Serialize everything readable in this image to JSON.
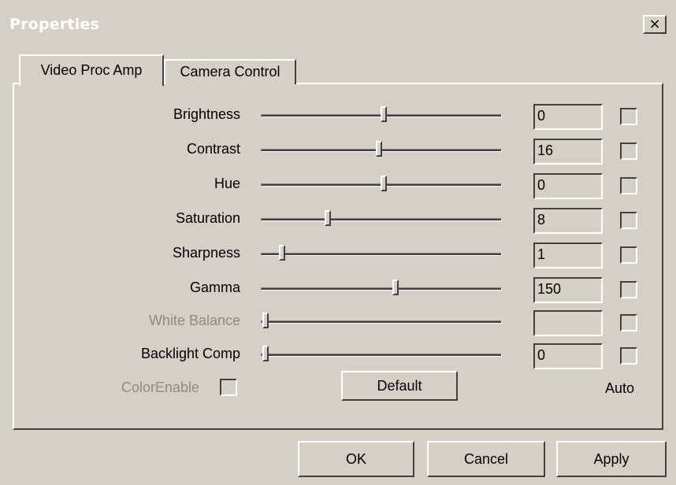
{
  "window": {
    "title": "Properties",
    "close_label": "×"
  },
  "tabs": [
    {
      "label": "Video Proc Amp",
      "active": true
    },
    {
      "label": "Camera Control",
      "active": false
    }
  ],
  "controls": [
    {
      "label": "Brightness",
      "value": "0",
      "level": 0.51,
      "enabled": true,
      "auto": false
    },
    {
      "label": "Contrast",
      "value": "16",
      "level": 0.49,
      "enabled": true,
      "auto": false
    },
    {
      "label": "Hue",
      "value": "0",
      "level": 0.51,
      "enabled": true,
      "auto": false
    },
    {
      "label": "Saturation",
      "value": "8",
      "level": 0.27,
      "enabled": true,
      "auto": false
    },
    {
      "label": "Sharpness",
      "value": "1",
      "level": 0.07,
      "enabled": true,
      "auto": false
    },
    {
      "label": "Gamma",
      "value": "150",
      "level": 0.56,
      "enabled": true,
      "auto": false
    },
    {
      "label": "White Balance",
      "value": "",
      "level": 0.0,
      "enabled": false,
      "auto": false
    },
    {
      "label": "Backlight Comp",
      "value": "0",
      "level": 0.0,
      "enabled": true,
      "auto": false
    }
  ],
  "color_enable": {
    "label": "ColorEnable",
    "checked": false
  },
  "default_button": "Default",
  "auto_label": "Auto",
  "buttons": {
    "ok": "OK",
    "cancel": "Cancel",
    "apply": "Apply"
  }
}
